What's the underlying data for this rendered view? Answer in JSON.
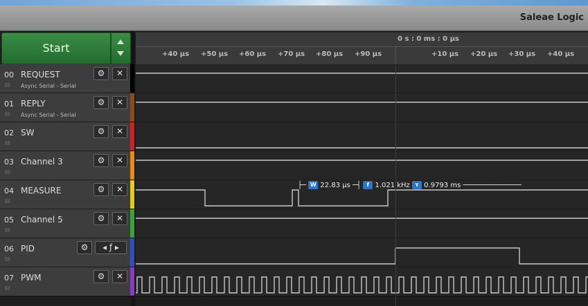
{
  "window": {
    "title": "Saleae Logic"
  },
  "start_button": {
    "label": "Start"
  },
  "ruler": {
    "center_label": "0 s : 0 ms : 0 μs",
    "left_ticks": [
      "+40 μs",
      "+50 μs",
      "+60 μs",
      "+70 μs",
      "+80 μs",
      "+90 μs"
    ],
    "right_ticks": [
      "+10 μs",
      "+20 μs",
      "+30 μs",
      "+40 μs"
    ]
  },
  "channels": [
    {
      "num": "00",
      "name": "REQUEST",
      "analyzer": "Async Serial - Serial",
      "color": "#000000"
    },
    {
      "num": "01",
      "name": "REPLY",
      "analyzer": "Async Serial - Serial",
      "color": "#8a4b1e"
    },
    {
      "num": "02",
      "name": "SW",
      "analyzer": "",
      "color": "#d12020"
    },
    {
      "num": "03",
      "name": "Channel 3",
      "analyzer": "",
      "color": "#e58a1a"
    },
    {
      "num": "04",
      "name": "MEASURE",
      "analyzer": "",
      "color": "#e6c81d"
    },
    {
      "num": "05",
      "name": "Channel 5",
      "analyzer": "",
      "color": "#3aa43a"
    },
    {
      "num": "06",
      "name": "PID",
      "analyzer": "",
      "color": "#2f4fbf"
    },
    {
      "num": "07",
      "name": "PWM",
      "analyzer": "",
      "color": "#8a3bbf"
    }
  ],
  "trigger_icon": "ƒ",
  "measurement": {
    "width_icon": "W",
    "width": "22.83 μs",
    "freq_icon": "f",
    "freq": "1.021 kHz",
    "period_icon": "τ",
    "period": "0.9793 ms"
  }
}
